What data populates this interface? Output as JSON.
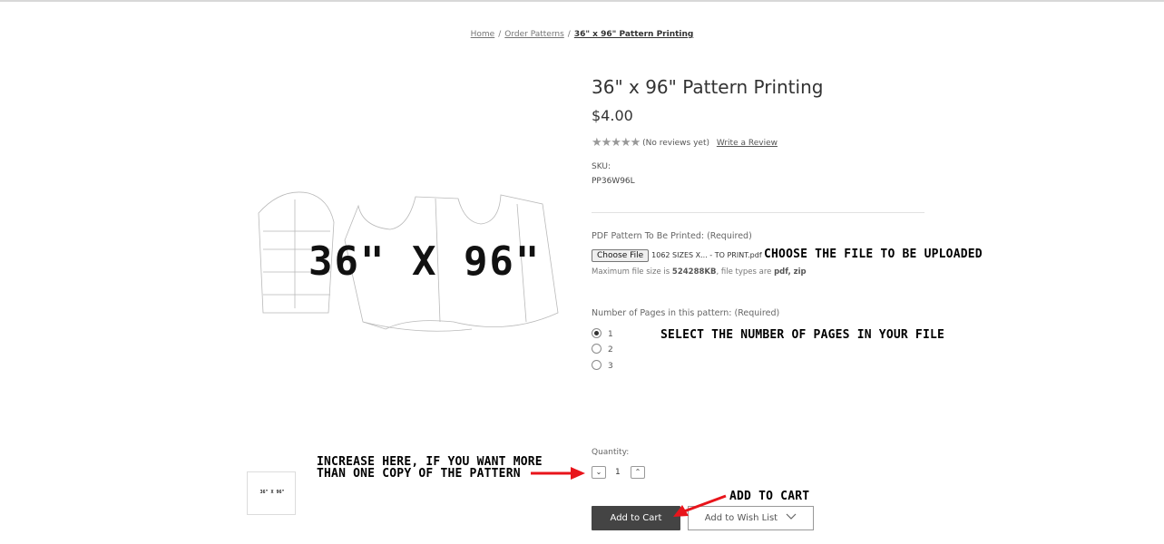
{
  "breadcrumb": {
    "home": "Home",
    "order_patterns": "Order Patterns",
    "current": "36\" x 96\" Pattern Printing"
  },
  "product": {
    "image_label": "36\" X 96\"",
    "thumb_label": "36\" X 96\"",
    "title": "36\" x 96\" Pattern Printing",
    "price": "$4.00",
    "stars": "★★★★★",
    "rating_count": 0,
    "reviews_text": "(No reviews yet)",
    "write_review": "Write a Review",
    "sku_label": "SKU:",
    "sku_value": "PP36W96L"
  },
  "upload": {
    "label": "PDF Pattern To Be Printed:  (Required)",
    "button": "Choose File",
    "filename": "1062 SIZES X... - TO PRINT.pdf",
    "help_prefix": "Maximum file size is ",
    "help_size": "524288KB",
    "help_mid": ", file types are ",
    "help_types": "pdf, zip"
  },
  "pages": {
    "label": "Number of Pages in this pattern:  (Required)",
    "options": [
      "1",
      "2",
      "3"
    ],
    "selected": "1"
  },
  "quantity": {
    "label": "Quantity:",
    "value": "1"
  },
  "actions": {
    "add_to_cart": "Add to Cart",
    "wishlist": "Add to Wish List"
  },
  "annotations": {
    "choose_file": "Choose the file to be uploaded",
    "select_pages": "Select the number of pages in your file",
    "increase_line1": "Increase here, if you want more",
    "increase_line2": "than one copy of the pattern",
    "add_to_cart": "Add to cart"
  },
  "colors": {
    "arrow": "#e8141b",
    "button_dark": "#444444"
  }
}
